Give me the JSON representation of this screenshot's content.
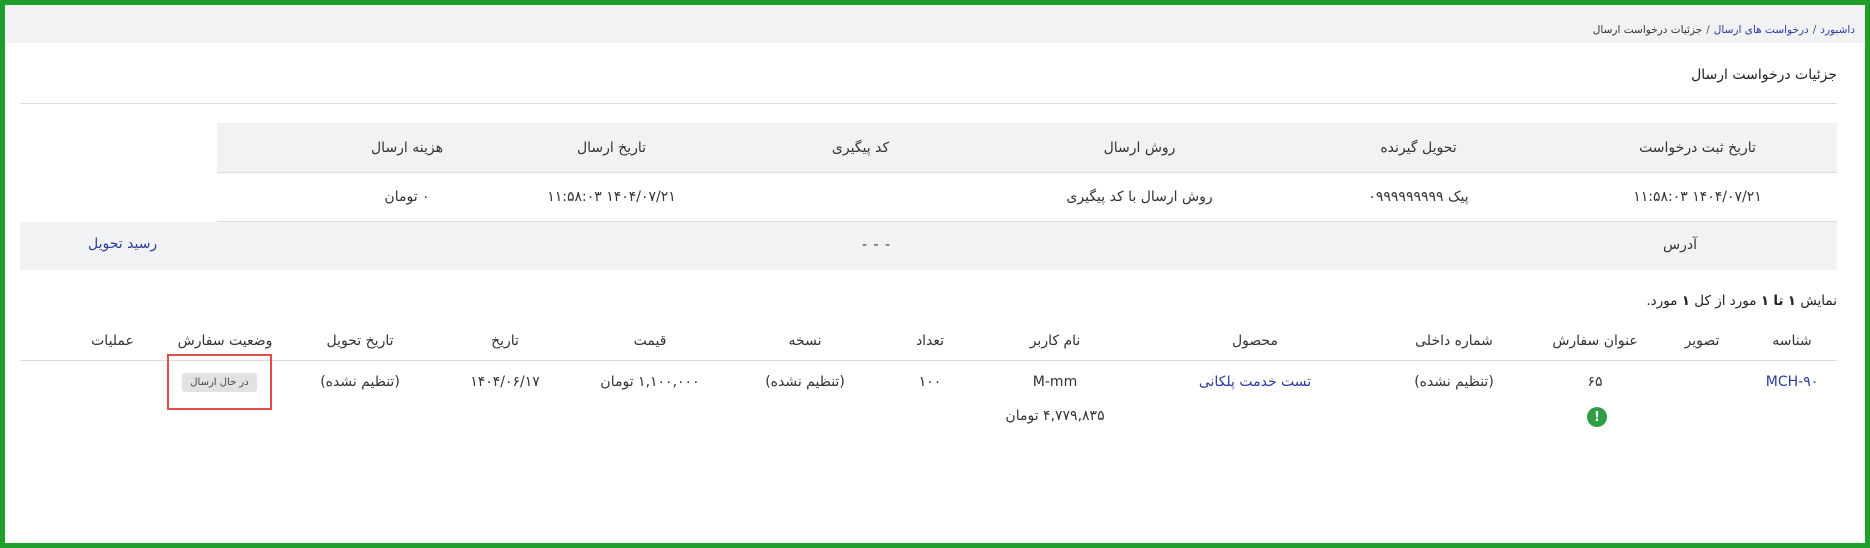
{
  "breadcrumb": {
    "home": "داشبورد",
    "sep": "/",
    "requests": "درخواست های ارسال",
    "current": "جزئیات درخواست ارسال"
  },
  "page": {
    "title": "جزئیات درخواست ارسال"
  },
  "details": {
    "headers": [
      "تاریخ ثبت درخواست",
      "تحویل گیرنده",
      "روش ارسال",
      "کد پیگیری",
      "تاریخ ارسال",
      "هزینه ارسال"
    ],
    "values": [
      "۱۴۰۴/۰۷/۲۱ ۱۱:۵۸:۰۳",
      "پیک ۰۹۹۹۹۹۹۹۹۹",
      "روش ارسال با کد پیگیری",
      "",
      "۱۴۰۴/۰۷/۲۱ ۱۱:۵۸:۰۳",
      "۰ تومان"
    ],
    "address_label": "آدرس",
    "address_value": "- - -",
    "receipt_link": "رسید تحویل"
  },
  "summary": {
    "prefix": "نمایش",
    "from": "۱",
    "to_word": "تا",
    "to": "۱",
    "mid": "مورد از کل",
    "total": "۱",
    "suffix": "مورد."
  },
  "orders": {
    "headers": [
      "شناسه",
      "تصویر",
      "عنوان سفارش",
      "شماره داخلی",
      "محصول",
      "نام کاربر",
      "تعداد",
      "نسخه",
      "قیمت",
      "تاریخ",
      "تاریخ تحویل",
      "وضعیت سفارش",
      "عملیات"
    ],
    "row": {
      "id": "MCH-۹۰",
      "title": "۶۵",
      "internal_no": "(تنظیم نشده)",
      "product": "تست خدمت پلکانی",
      "user": "M-mm",
      "user_amount": "۴,۷۷۹,۸۳۵ تومان",
      "qty": "۱۰۰",
      "version": "(تنظیم نشده)",
      "price": "۱,۱۰۰,۰۰۰ تومان",
      "date": "۱۴۰۴/۰۶/۱۷",
      "delivery_date": "(تنظیم نشده)",
      "status": "در حال ارسال",
      "alert_icon": "!"
    }
  },
  "colors": {
    "frame": "#1f9e2c",
    "link": "#2d3a9e",
    "highlight": "#e04b4b"
  }
}
